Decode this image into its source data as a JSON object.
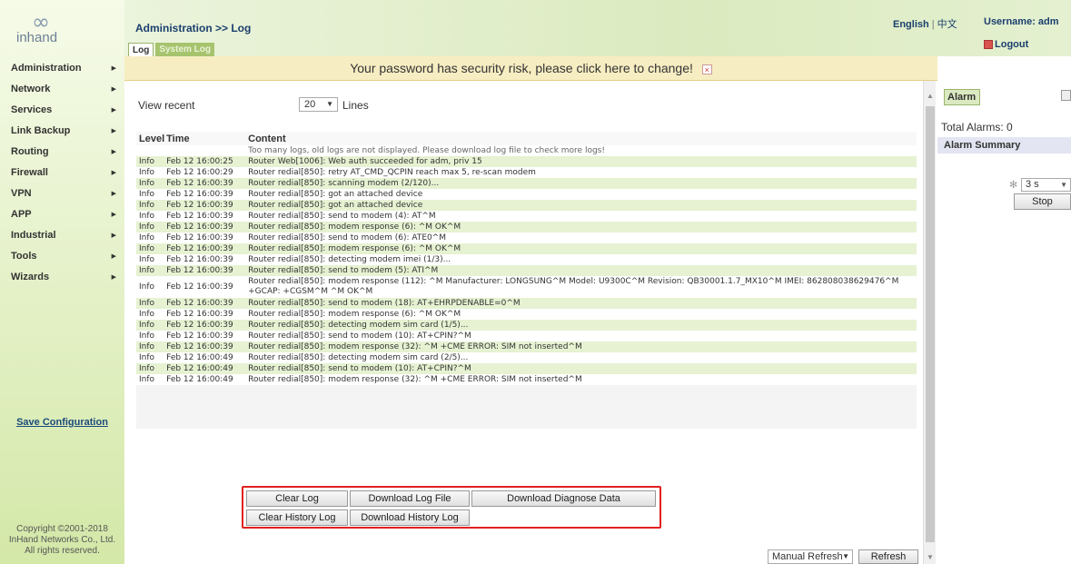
{
  "brand": {
    "logo_mark": "∞",
    "logo_text": "inhand"
  },
  "sidebar": {
    "items": [
      {
        "label": "Administration"
      },
      {
        "label": "Network"
      },
      {
        "label": "Services"
      },
      {
        "label": "Link Backup"
      },
      {
        "label": "Routing"
      },
      {
        "label": "Firewall"
      },
      {
        "label": "VPN"
      },
      {
        "label": "APP"
      },
      {
        "label": "Industrial"
      },
      {
        "label": "Tools"
      },
      {
        "label": "Wizards"
      }
    ],
    "save_config": "Save Configuration",
    "copyright": [
      "Copyright ©2001-2018",
      "InHand Networks Co., Ltd.",
      "All rights reserved."
    ]
  },
  "header": {
    "title": "Administration >> Log",
    "tabs": [
      {
        "label": "Log"
      },
      {
        "label": "System Log"
      }
    ],
    "lang_en": "English",
    "lang_sep": "|",
    "lang_zh": "中文",
    "username": "Username: adm",
    "logout": "Logout"
  },
  "banner": {
    "text": "Your password has security risk, please click here to change!",
    "close": "×"
  },
  "controls": {
    "view_recent": "View recent",
    "lines_value": "20",
    "lines_label": "Lines"
  },
  "log": {
    "headers": [
      "Level",
      "Time",
      "Content"
    ],
    "notice": "Too many logs, old logs are not displayed. Please download log file to check more logs!",
    "rows": [
      {
        "level": "Info",
        "time": "Feb 12 16:00:25",
        "content": "Router Web[1006]: Web auth succeeded for adm, priv 15"
      },
      {
        "level": "Info",
        "time": "Feb 12 16:00:29",
        "content": "Router redial[850]: retry AT_CMD_QCPIN reach max 5, re-scan modem"
      },
      {
        "level": "Info",
        "time": "Feb 12 16:00:39",
        "content": "Router redial[850]: scanning modem (2/120)..."
      },
      {
        "level": "Info",
        "time": "Feb 12 16:00:39",
        "content": "Router redial[850]: got an attached device"
      },
      {
        "level": "Info",
        "time": "Feb 12 16:00:39",
        "content": "Router redial[850]: got an attached device"
      },
      {
        "level": "Info",
        "time": "Feb 12 16:00:39",
        "content": "Router redial[850]: send to modem (4): AT^M"
      },
      {
        "level": "Info",
        "time": "Feb 12 16:00:39",
        "content": "Router redial[850]: modem response (6): ^M OK^M"
      },
      {
        "level": "Info",
        "time": "Feb 12 16:00:39",
        "content": "Router redial[850]: send to modem (6): ATE0^M"
      },
      {
        "level": "Info",
        "time": "Feb 12 16:00:39",
        "content": "Router redial[850]: modem response (6): ^M OK^M"
      },
      {
        "level": "Info",
        "time": "Feb 12 16:00:39",
        "content": "Router redial[850]: detecting modem imei (1/3)..."
      },
      {
        "level": "Info",
        "time": "Feb 12 16:00:39",
        "content": "Router redial[850]: send to modem (5): ATI^M"
      },
      {
        "level": "Info",
        "time": "Feb 12 16:00:39",
        "content": "Router redial[850]: modem response (112): ^M Manufacturer: LONGSUNG^M Model: U9300C^M Revision: QB30001.1.7_MX10^M IMEI: 862808038629476^M +GCAP: +CGSM^M ^M OK^M"
      },
      {
        "level": "Info",
        "time": "Feb 12 16:00:39",
        "content": "Router redial[850]: send to modem (18): AT+EHRPDENABLE=0^M"
      },
      {
        "level": "Info",
        "time": "Feb 12 16:00:39",
        "content": "Router redial[850]: modem response (6): ^M OK^M"
      },
      {
        "level": "Info",
        "time": "Feb 12 16:00:39",
        "content": "Router redial[850]: detecting modem sim card (1/5)..."
      },
      {
        "level": "Info",
        "time": "Feb 12 16:00:39",
        "content": "Router redial[850]: send to modem (10): AT+CPIN?^M"
      },
      {
        "level": "Info",
        "time": "Feb 12 16:00:39",
        "content": "Router redial[850]: modem response (32): ^M +CME ERROR: SIM not inserted^M"
      },
      {
        "level": "Info",
        "time": "Feb 12 16:00:49",
        "content": "Router redial[850]: detecting modem sim card (2/5)..."
      },
      {
        "level": "Info",
        "time": "Feb 12 16:00:49",
        "content": "Router redial[850]: send to modem (10): AT+CPIN?^M"
      },
      {
        "level": "Info",
        "time": "Feb 12 16:00:49",
        "content": "Router redial[850]: modem response (32): ^M +CME ERROR: SIM not inserted^M"
      }
    ]
  },
  "buttons": {
    "clear_log": "Clear Log",
    "download_log_file": "Download Log File",
    "download_diagnose_data": "Download Diagnose Data",
    "clear_history_log": "Clear History Log",
    "download_history_log": "Download History Log"
  },
  "footer": {
    "refresh_mode": "Manual Refresh",
    "refresh": "Refresh"
  },
  "alarm": {
    "tab": "Alarm",
    "total": "Total Alarms: 0",
    "summary": "Alarm Summary",
    "interval": "3 s",
    "stop": "Stop"
  },
  "colors": {
    "row_alt": "#e6f2d2",
    "highlight_border": "#e02020",
    "banner_bg": "#f7edc2",
    "link": "#1b4a7a"
  }
}
